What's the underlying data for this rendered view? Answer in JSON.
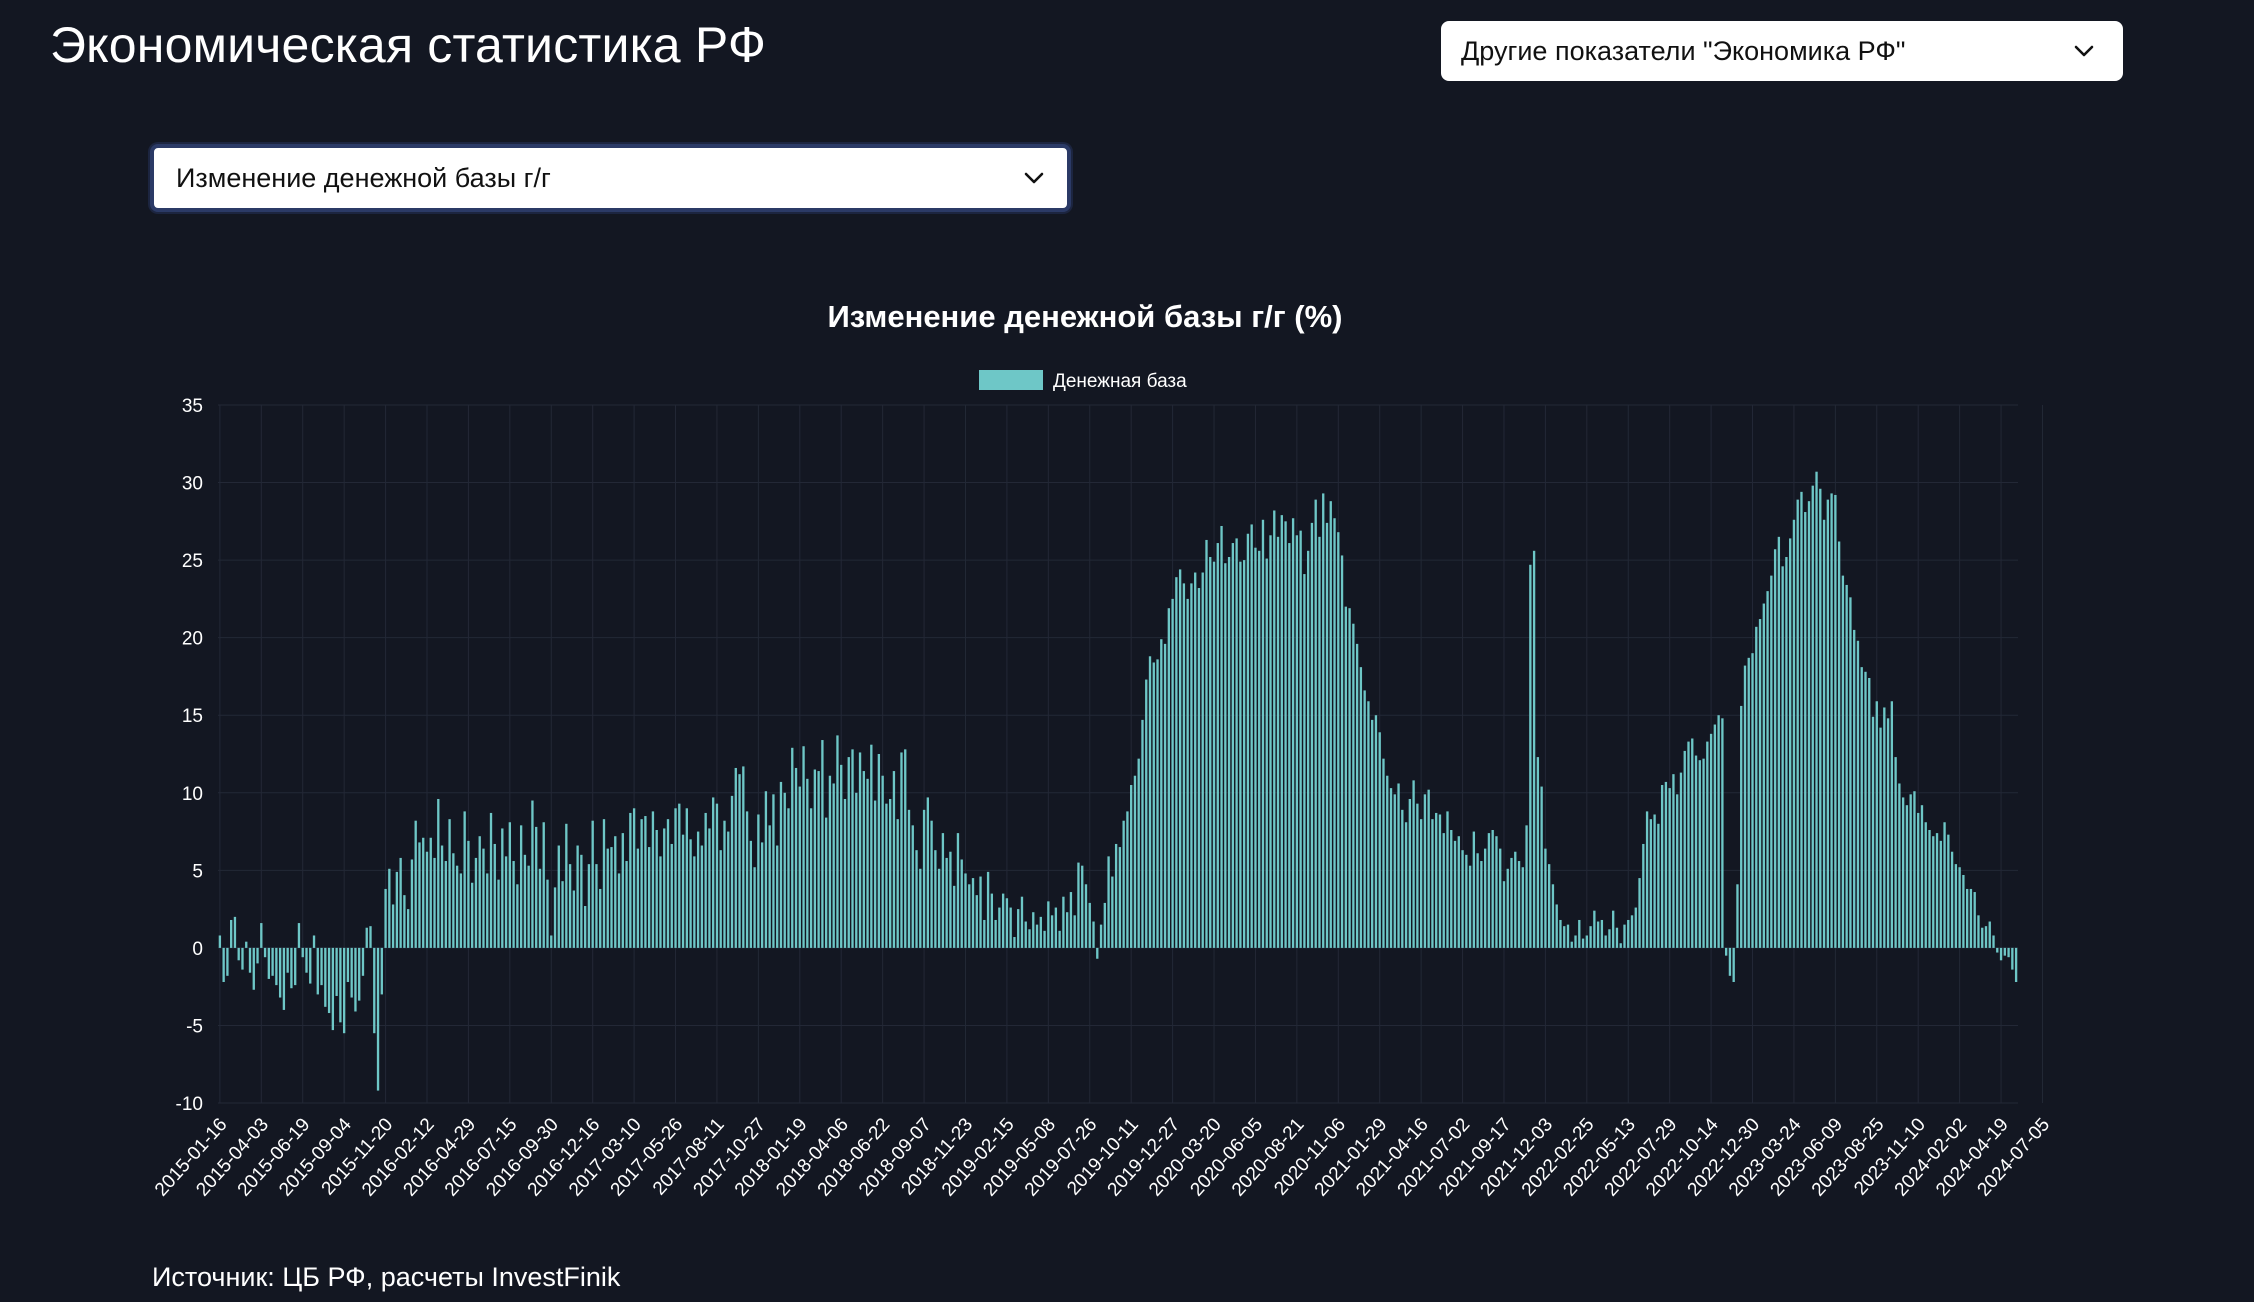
{
  "header": {
    "title": "Экономическая статистика РФ",
    "other_select_value": "Другие показатели \"Экономика РФ\"",
    "chevron_icon": "chevron-down-icon"
  },
  "metric_select": {
    "value": "Изменение денежной базы г/г"
  },
  "footer": {
    "source": "Источник: ЦБ РФ, расчеты InvestFinik"
  },
  "colors": {
    "background": "#131722",
    "bar": "#6ec7c7",
    "grid": "#232836",
    "text": "#ffffff"
  },
  "chart_data": {
    "type": "bar",
    "title": "Изменение денежной базы г/г (%)",
    "legend": "Денежная база",
    "legend_position": "top-center",
    "grid": true,
    "ylim": [
      -10,
      35
    ],
    "yticks": [
      35,
      30,
      25,
      20,
      15,
      10,
      5,
      0,
      -5,
      -10
    ],
    "xtick_labels": [
      "2015-01-16",
      "2015-04-03",
      "2015-06-19",
      "2015-09-04",
      "2015-11-20",
      "2016-02-12",
      "2016-04-29",
      "2016-07-15",
      "2016-09-30",
      "2016-12-16",
      "2017-03-10",
      "2017-05-26",
      "2017-08-11",
      "2017-10-27",
      "2018-01-19",
      "2018-04-06",
      "2018-06-22",
      "2018-09-07",
      "2018-11-23",
      "2019-02-15",
      "2019-05-08",
      "2019-07-26",
      "2019-10-11",
      "2019-12-27",
      "2020-03-20",
      "2020-06-05",
      "2020-08-21",
      "2020-11-06",
      "2021-01-29",
      "2021-04-16",
      "2021-07-02",
      "2021-09-17",
      "2021-12-03",
      "2022-02-25",
      "2022-05-13",
      "2022-07-29",
      "2022-10-14",
      "2022-12-30",
      "2023-03-24",
      "2023-06-09",
      "2023-08-25",
      "2023-11-10",
      "2024-02-02",
      "2024-04-19",
      "2024-07-05"
    ],
    "bars_per_tick": 11,
    "series": [
      {
        "name": "Денежная база",
        "values": [
          0.8,
          -2.2,
          -1.8,
          1.8,
          2,
          -0.8,
          -1.4,
          0.4,
          -1.6,
          -2.7,
          -1,
          1.6,
          -0.6,
          -2,
          -1.8,
          -2.4,
          -3.2,
          -4,
          -1.6,
          -2.6,
          -2.4,
          1.6,
          -0.6,
          -1.6,
          -2.3,
          0.8,
          -3,
          -2.4,
          -3.8,
          -4.2,
          -5.3,
          -3.1,
          -4.8,
          -5.5,
          -2.2,
          -3.2,
          -4.1,
          -3.4,
          -1.8,
          1.3,
          1.4,
          -5.5,
          -9.2,
          -3,
          3.8,
          5.1,
          2.8,
          4.9,
          5.8,
          3.4,
          2.5,
          5.7,
          8.2,
          6.8,
          7.1,
          6.2,
          7.1,
          5.8,
          9.6,
          6.6,
          5.6,
          8.3,
          6.1,
          5.3,
          4.8,
          8.8,
          6.9,
          4.2,
          5.8,
          7.2,
          6.4,
          4.8,
          8.7,
          6.7,
          4.4,
          7.7,
          5.9,
          8.1,
          5.6,
          4.1,
          7.9,
          6,
          5.3,
          9.5,
          7.8,
          5.1,
          8.1,
          4.4,
          0.8,
          3.9,
          6.6,
          4.3,
          8,
          5.4,
          3.7,
          6.6,
          6,
          2.7,
          5.4,
          8.2,
          5.4,
          3.8,
          8.3,
          6.4,
          6.5,
          7.2,
          4.8,
          7.4,
          5.6,
          8.7,
          9,
          6.4,
          8.3,
          8.5,
          6.5,
          8.8,
          7.6,
          5.9,
          7.7,
          8.3,
          6.7,
          9,
          9.3,
          7.3,
          9,
          7,
          5.9,
          7.5,
          6.6,
          8.7,
          7.7,
          9.7,
          9.3,
          6.3,
          8.2,
          7.5,
          9.8,
          11.6,
          11.2,
          11.7,
          8.8,
          6.9,
          5.2,
          8.6,
          6.8,
          10.1,
          7.9,
          9.9,
          6.6,
          10.7,
          10,
          9,
          12.9,
          11.6,
          10.4,
          13,
          10.9,
          9,
          11.5,
          11.4,
          13.4,
          8.4,
          11.1,
          10.6,
          13.7,
          11.8,
          9.6,
          12.3,
          12.8,
          10,
          12.6,
          11.4,
          10.9,
          13.1,
          9.5,
          12.5,
          11.1,
          9.3,
          9.6,
          11.4,
          8.3,
          12.6,
          12.8,
          8.9,
          7.9,
          6.3,
          5.1,
          8.9,
          9.7,
          8.2,
          6.3,
          5.1,
          7.4,
          5.8,
          6.2,
          4,
          7.4,
          5.7,
          4.8,
          4.1,
          4.5,
          3.4,
          4.6,
          1.8,
          4.9,
          3.5,
          1.8,
          2.6,
          3.5,
          3.2,
          2.6,
          0.7,
          2.5,
          3.3,
          1.7,
          1.2,
          2.3,
          1.5,
          2,
          1.1,
          3,
          2.1,
          2.6,
          1.1,
          3.3,
          2.3,
          3.6,
          2.1,
          5.5,
          5.3,
          4.1,
          2.9,
          1.7,
          -0.7,
          1.5,
          2.9,
          5.9,
          4.6,
          6.7,
          6.5,
          8.2,
          8.8,
          10.5,
          11.1,
          12.2,
          14.7,
          17.3,
          18.8,
          18.4,
          18.6,
          19.9,
          19.6,
          21.9,
          22.5,
          23.9,
          24.4,
          23.5,
          22.5,
          23.5,
          24.2,
          23.2,
          24.2,
          26.3,
          25.2,
          24.9,
          26.1,
          27.2,
          24.8,
          25.2,
          26.1,
          26.4,
          24.9,
          25,
          26.7,
          27.3,
          25.8,
          25.6,
          27.6,
          25.1,
          26.6,
          28.2,
          26.5,
          27.9,
          27.5,
          26.1,
          27.7,
          26.6,
          26.9,
          24.1,
          25.6,
          27.4,
          28.9,
          26.5,
          29.3,
          27.4,
          28.8,
          27.7,
          26.8,
          25.3,
          22,
          21.9,
          20.9,
          19.6,
          18.1,
          16.6,
          15.9,
          14.7,
          15,
          13.9,
          12.2,
          11.1,
          10.3,
          9.9,
          10.6,
          8.9,
          8.1,
          9.6,
          10.8,
          9.3,
          8.3,
          9.9,
          10.2,
          8.3,
          8.7,
          8.6,
          7.4,
          8.8,
          7.6,
          6.9,
          7.2,
          6.3,
          6,
          5.3,
          7.5,
          6.1,
          5.6,
          6.4,
          7.4,
          7.6,
          7.2,
          6.4,
          4.3,
          5.1,
          5.8,
          6.2,
          5.6,
          5.2,
          7.9,
          24.7,
          25.6,
          12.3,
          10.4,
          6.4,
          5.4,
          4.1,
          2.8,
          1.8,
          1.4,
          1.5,
          0.4,
          0.8,
          1.8,
          0.6,
          0.8,
          1.4,
          2.4,
          1.7,
          1.8,
          0.8,
          1.2,
          2.4,
          1.3,
          0.3,
          1.5,
          1.8,
          2.1,
          2.6,
          4.5,
          6.7,
          8.8,
          8.3,
          8.6,
          8,
          10.5,
          10.7,
          10.3,
          11.2,
          9.9,
          11.3,
          12.7,
          13.3,
          13.5,
          12.4,
          12.1,
          12.2,
          13.3,
          13.8,
          14.4,
          15,
          14.8,
          -0.5,
          -1.8,
          -2.2,
          4.1,
          15.6,
          18.2,
          18.7,
          19,
          20.7,
          21.2,
          22.2,
          23,
          24,
          25.7,
          26.5,
          24.6,
          25.2,
          26.4,
          27.6,
          28.9,
          29.4,
          28.1,
          28.8,
          29.8,
          30.7,
          29.6,
          27.6,
          28.9,
          29.3,
          29.2,
          26.2,
          24,
          23.4,
          22.6,
          20.5,
          19.8,
          18.1,
          17.8,
          17.4,
          14.9,
          15.9,
          14.2,
          15.5,
          14.8,
          15.9,
          12.3,
          10.6,
          9.7,
          9.2,
          9.9,
          10.1,
          8.7,
          9.2,
          8.1,
          7.6,
          7.2,
          7.4,
          6.9,
          8.1,
          7.3,
          6.2,
          5.4,
          5.2,
          4.7,
          3.8,
          3.8,
          3.6,
          2.1,
          1.3,
          1.4,
          1.7,
          0.8,
          -0.3,
          -0.8,
          -0.5,
          -0.6,
          -1.4,
          -2.2
        ]
      }
    ]
  }
}
